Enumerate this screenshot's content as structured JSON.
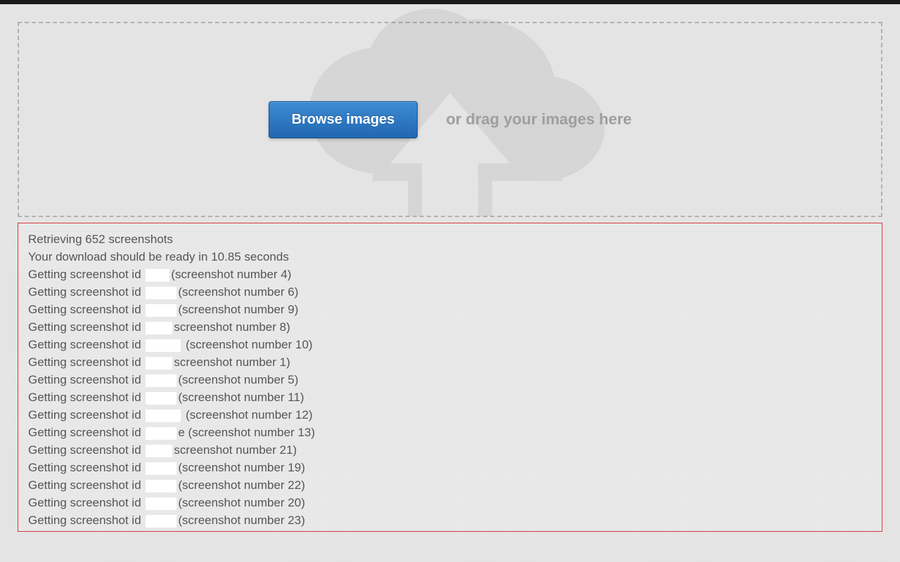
{
  "dropzone": {
    "browse_label": "Browse images",
    "drag_hint": "or drag your images here"
  },
  "log": {
    "header_lines": [
      "Retrieving 652 screenshots",
      "Your download should be ready in 10.85 seconds"
    ],
    "entries": [
      {
        "prefix": "Getting screenshot id ",
        "redact_width": 34,
        "suffix": "(screenshot number 4)"
      },
      {
        "prefix": "Getting screenshot id ",
        "redact_width": 44,
        "suffix": "(screenshot number 6)"
      },
      {
        "prefix": "Getting screenshot id ",
        "redact_width": 44,
        "suffix": "(screenshot number 9)"
      },
      {
        "prefix": "Getting screenshot id ",
        "redact_width": 38,
        "suffix": "screenshot number 8)"
      },
      {
        "prefix": "Getting screenshot id ",
        "redact_width": 50,
        "suffix": " (screenshot number 10)"
      },
      {
        "prefix": "Getting screenshot id ",
        "redact_width": 38,
        "suffix": "screenshot number 1)"
      },
      {
        "prefix": "Getting screenshot id ",
        "redact_width": 44,
        "suffix": "(screenshot number 5)"
      },
      {
        "prefix": "Getting screenshot id ",
        "redact_width": 44,
        "suffix": "(screenshot number 11)"
      },
      {
        "prefix": "Getting screenshot id ",
        "redact_width": 50,
        "suffix": " (screenshot number 12)"
      },
      {
        "prefix": "Getting screenshot id ",
        "redact_width": 44,
        "suffix": "e (screenshot number 13)"
      },
      {
        "prefix": "Getting screenshot id ",
        "redact_width": 38,
        "suffix": "screenshot number 21)"
      },
      {
        "prefix": "Getting screenshot id ",
        "redact_width": 44,
        "suffix": "(screenshot number 19)"
      },
      {
        "prefix": "Getting screenshot id ",
        "redact_width": 44,
        "suffix": "(screenshot number 22)"
      },
      {
        "prefix": "Getting screenshot id ",
        "redact_width": 44,
        "suffix": "(screenshot number 20)"
      },
      {
        "prefix": "Getting screenshot id ",
        "redact_width": 44,
        "suffix": "(screenshot number 23)"
      }
    ]
  }
}
